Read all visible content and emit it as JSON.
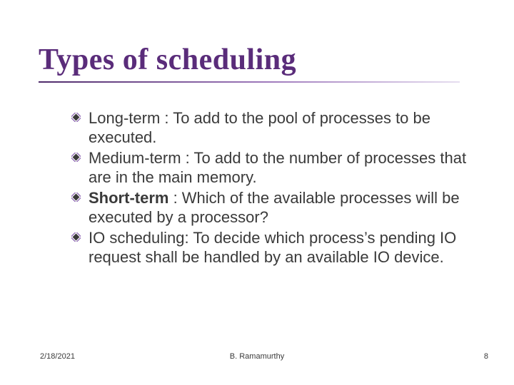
{
  "title": "Types of scheduling",
  "bullets": [
    {
      "text": "Long-term : To add to the pool of processes to be executed.",
      "bold_prefix": ""
    },
    {
      "text": "Medium-term : To add to the number of processes that are in the main memory.",
      "bold_prefix": ""
    },
    {
      "bold_prefix": "Short-term",
      "text": " : Which of the available processes will be executed by a processor?"
    },
    {
      "text": "IO scheduling: To decide which process’s pending IO request shall be handled by an available IO device.",
      "bold_prefix": ""
    }
  ],
  "footer": {
    "date": "2/18/2021",
    "author": "B. Ramamurthy",
    "page": "8"
  }
}
